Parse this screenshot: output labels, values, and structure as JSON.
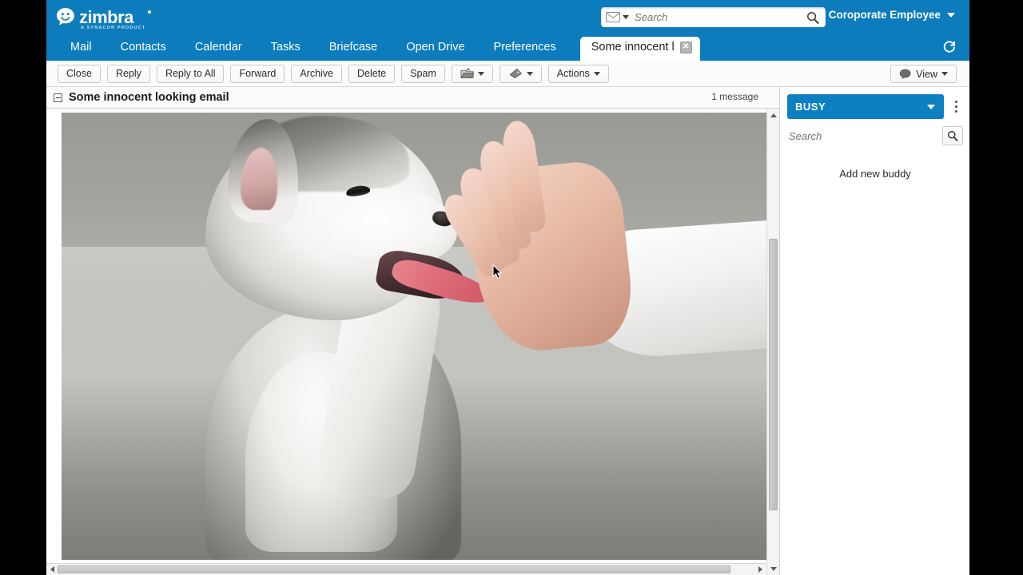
{
  "brand": {
    "logo_text": "zimbra",
    "logo_tagline": "A SYNACOR PRODUCT",
    "accent_blue": "#0c7cbd",
    "status_blue": "#0d80c1"
  },
  "header": {
    "search": {
      "placeholder": "Search",
      "value": "",
      "type_icon": "envelope-icon",
      "go_icon": "search-icon"
    },
    "user": {
      "name": "Coroporate Employee",
      "caret_icon": "chevron-down-icon"
    }
  },
  "nav": {
    "tabs": [
      {
        "label": "Mail",
        "active": false
      },
      {
        "label": "Contacts",
        "active": false
      },
      {
        "label": "Calendar",
        "active": false
      },
      {
        "label": "Tasks",
        "active": false
      },
      {
        "label": "Briefcase",
        "active": false
      },
      {
        "label": "Open Drive",
        "active": false
      },
      {
        "label": "Preferences",
        "active": false
      }
    ],
    "active_tab": {
      "label": "Some innocent l",
      "close_icon": "close-icon",
      "close_glyph": "✕"
    },
    "refresh_icon": "refresh-icon"
  },
  "toolbar": {
    "close_label": "Close",
    "reply_label": "Reply",
    "reply_all_label": "Reply to All",
    "forward_label": "Forward",
    "archive_label": "Archive",
    "delete_label": "Delete",
    "spam_label": "Spam",
    "move_icon": "folder-move-icon",
    "tag_icon": "tag-icon",
    "actions_label": "Actions",
    "view_label": "View",
    "view_icon": "conversation-bubble-icon"
  },
  "conversation": {
    "subject": "Some innocent looking email",
    "message_count": "1 message",
    "collapse_icon": "collapse-minus-icon"
  },
  "message_body": {
    "image_alt": "husky puppy high-fiving a human hand",
    "cursor_icon": "mouse-pointer-icon"
  },
  "chat_sidebar": {
    "status": "BUSY",
    "status_caret_icon": "chevron-down-icon",
    "options_icon": "kebab-menu-icon",
    "search_placeholder": "Search",
    "search_value": "",
    "search_icon": "search-icon",
    "add_buddy_label": "Add new buddy"
  }
}
